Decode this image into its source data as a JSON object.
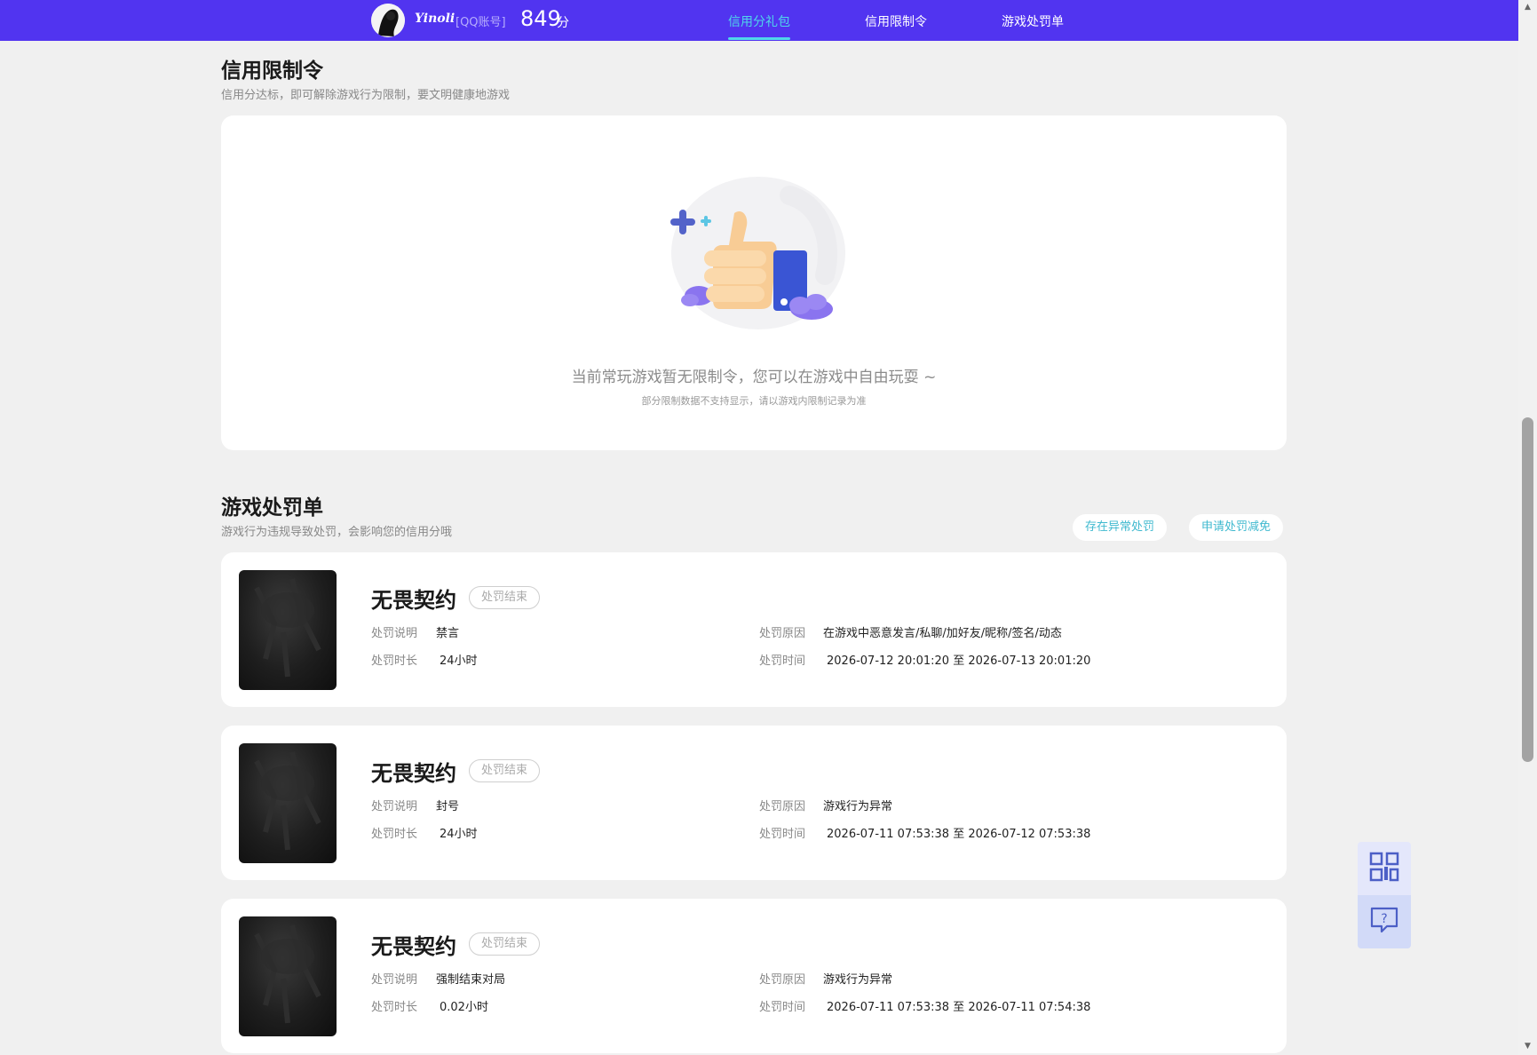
{
  "header": {
    "username": "Yinoli",
    "account_type": "[QQ账号]",
    "score": "849",
    "score_unit": "分",
    "tabs": [
      {
        "label": "信用分礼包",
        "active": true
      },
      {
        "label": "信用限制令",
        "active": false
      },
      {
        "label": "游戏处罚单",
        "active": false
      }
    ]
  },
  "restriction": {
    "title": "信用限制令",
    "subtitle": "信用分达标，即可解除游戏行为限制，要文明健康地游戏",
    "empty_message": "当前常玩游戏暂无限制令，您可以在游戏中自由玩耍 ~",
    "empty_hint": "部分限制数据不支持显示，请以游戏内限制记录为准"
  },
  "penalty": {
    "title": "游戏处罚单",
    "subtitle": "游戏行为违规导致处罚，会影响您的信用分哦",
    "buttons": {
      "abnormal": "存在异常处罚",
      "reduce": "申请处罚减免"
    },
    "labels": {
      "desc": "处罚说明",
      "duration": "处罚时长",
      "reason": "处罚原因",
      "time": "处罚时间"
    },
    "items": [
      {
        "game": "无畏契约",
        "status": "处罚结束",
        "desc": "禁言",
        "duration": "24小时",
        "reason": "在游戏中恶意发言/私聊/加好友/昵称/签名/动态",
        "time": "2026-07-12 20:01:20 至 2026-07-13 20:01:20"
      },
      {
        "game": "无畏契约",
        "status": "处罚结束",
        "desc": "封号",
        "duration": "24小时",
        "reason": "游戏行为异常",
        "time": "2026-07-11 07:53:38 至 2026-07-12 07:53:38"
      },
      {
        "game": "无畏契约",
        "status": "处罚结束",
        "desc": "强制结束对局",
        "duration": "0.02小时",
        "reason": "游戏行为异常",
        "time": "2026-07-11 07:53:38 至 2026-07-11 07:54:38"
      }
    ]
  },
  "icons": {
    "avatar": "avatar-image",
    "illustration": "thumbs-up-illustration",
    "qr": "qr-code-icon",
    "feedback": "feedback-question-icon"
  },
  "colors": {
    "header_bg": "#5134f0",
    "active_tab": "#4fd7ea",
    "pill_text": "#3fb9cf",
    "page_bg": "#f0f0f0"
  }
}
